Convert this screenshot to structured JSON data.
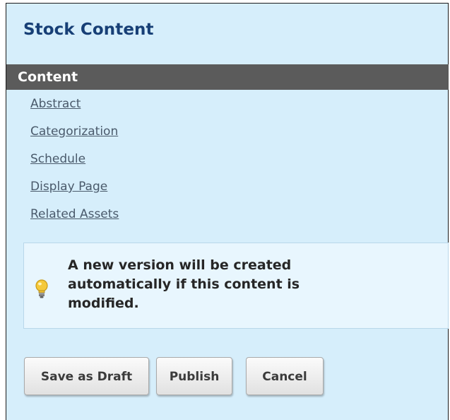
{
  "panel": {
    "title": "Stock Content"
  },
  "section": {
    "header": "Content",
    "links": [
      {
        "label": "Abstract"
      },
      {
        "label": "Categorization"
      },
      {
        "label": "Schedule"
      },
      {
        "label": "Display Page"
      },
      {
        "label": "Related Assets"
      }
    ]
  },
  "notice": {
    "icon": "lightbulb-icon",
    "message": "A new version will be created automatically if this content is modified."
  },
  "actions": {
    "save_draft": "Save as Draft",
    "publish": "Publish",
    "cancel": "Cancel"
  },
  "colors": {
    "panel_bg": "#d6eefb",
    "title": "#173f76",
    "header_bg": "#5b5b5b",
    "link": "#4a5a6b",
    "bulb": "#f2c230"
  }
}
